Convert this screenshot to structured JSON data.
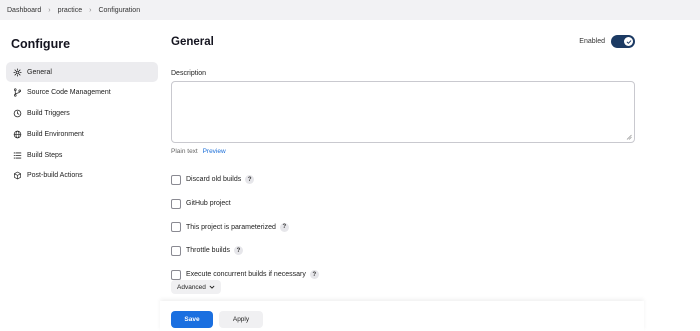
{
  "breadcrumb": [
    "Dashboard",
    "practice",
    "Configuration"
  ],
  "sidebar": {
    "title": "Configure",
    "items": [
      {
        "label": "General",
        "icon": "gear-icon",
        "active": true
      },
      {
        "label": "Source Code Management",
        "icon": "branch-icon",
        "active": false
      },
      {
        "label": "Build Triggers",
        "icon": "clock-icon",
        "active": false
      },
      {
        "label": "Build Environment",
        "icon": "globe-icon",
        "active": false
      },
      {
        "label": "Build Steps",
        "icon": "list-icon",
        "active": false
      },
      {
        "label": "Post-build Actions",
        "icon": "cube-icon",
        "active": false
      }
    ]
  },
  "general": {
    "title": "General",
    "enabled_label": "Enabled",
    "enabled": true,
    "description_label": "Description",
    "description_value": "",
    "plain_text_label": "Plain text",
    "preview_label": "Preview",
    "options": [
      {
        "label": "Discard old builds",
        "checked": false,
        "help": "?"
      },
      {
        "label": "GitHub project",
        "checked": false,
        "help": ""
      },
      {
        "label": "This project is parameterized",
        "checked": false,
        "help": "?"
      },
      {
        "label": "Throttle builds",
        "checked": false,
        "help": "?"
      },
      {
        "label": "Execute concurrent builds if necessary",
        "checked": false,
        "help": "?"
      }
    ],
    "advanced_label": "Advanced"
  },
  "footer": {
    "save_label": "Save",
    "apply_label": "Apply"
  },
  "colors": {
    "accent": "#1a6fe0",
    "toggle_on": "#1c3a63",
    "link": "#1a6ed8"
  }
}
